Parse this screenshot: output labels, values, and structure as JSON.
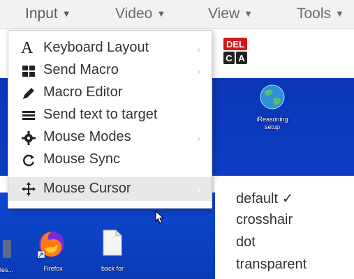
{
  "menubar": {
    "items": [
      {
        "label": "Input",
        "active": true
      },
      {
        "label": "Video"
      },
      {
        "label": "View"
      },
      {
        "label": "Tools"
      }
    ]
  },
  "toolbar": {
    "del_text": "DEL",
    "c_text": "C",
    "a_text": "A"
  },
  "input_menu": {
    "items": [
      {
        "label": "Keyboard Layout",
        "icon": "letter-a-icon",
        "has_submenu": true
      },
      {
        "label": "Send Macro",
        "icon": "grid-icon",
        "has_submenu": true
      },
      {
        "label": "Macro Editor",
        "icon": "pencil-icon",
        "has_submenu": false
      },
      {
        "label": "Send text to target",
        "icon": "lines-icon",
        "has_submenu": false
      },
      {
        "label": "Mouse Modes",
        "icon": "gear-icon",
        "has_submenu": true
      },
      {
        "label": "Mouse Sync",
        "icon": "sync-icon",
        "has_submenu": false
      },
      {
        "label": "Mouse Cursor",
        "icon": "move-icon",
        "has_submenu": true,
        "highlighted": true
      }
    ],
    "submenu_arrow": "›"
  },
  "cursor_submenu": {
    "items": [
      {
        "label": "default ✓",
        "checked": true
      },
      {
        "label": "crosshair"
      },
      {
        "label": "dot"
      },
      {
        "label": "transparent"
      }
    ]
  },
  "desktop": {
    "icons": [
      {
        "label": "iReasoning setup",
        "icon": "globe-icon"
      },
      {
        "label": "Firefox",
        "icon": "firefox-icon"
      },
      {
        "label": "back for",
        "icon": "file-icon"
      },
      {
        "label": "les...",
        "icon": "partial-icon"
      }
    ]
  },
  "colors": {
    "desktop_blue": "#0c3cc4",
    "menubar_bg": "#f2f2f2",
    "highlight": "#e8e8e8"
  }
}
